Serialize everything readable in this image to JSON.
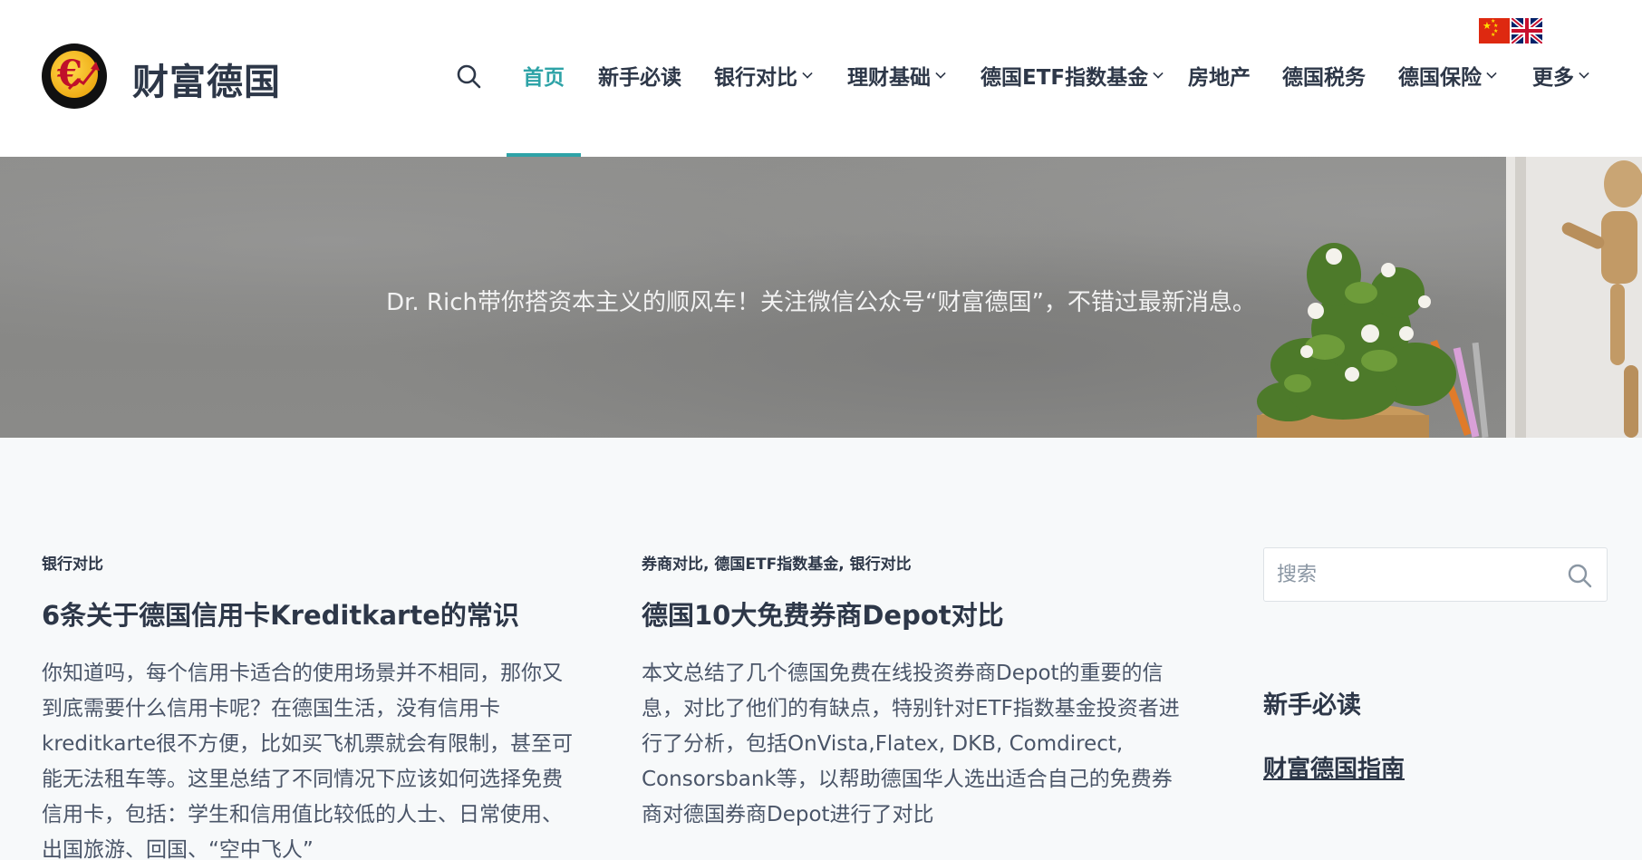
{
  "site": {
    "title": "财富德国"
  },
  "nav": {
    "items": [
      {
        "label": "首页",
        "active": true,
        "dropdown": false
      },
      {
        "label": "新手必读",
        "active": false,
        "dropdown": false
      },
      {
        "label": "银行对比",
        "active": false,
        "dropdown": true
      },
      {
        "label": "理财基础",
        "active": false,
        "dropdown": true
      },
      {
        "label": "德国ETF指数基金",
        "active": false,
        "dropdown": true
      },
      {
        "label": "房地产",
        "active": false,
        "dropdown": false
      },
      {
        "label": "德国税务",
        "active": false,
        "dropdown": false
      },
      {
        "label": "德国保险",
        "active": false,
        "dropdown": true
      },
      {
        "label": "更多",
        "active": false,
        "dropdown": true
      }
    ],
    "accent_color": "#2ea3a7"
  },
  "banner": {
    "text": "Dr. Rich带你搭资本主义的顺风车！关注微信公众号“财富德国”，不错过最新消息。"
  },
  "posts": [
    {
      "category": "银行对比",
      "title": "6条关于德国信用卡Kreditkarte的常识",
      "excerpt_lines": [
        "你知道吗，每个信用卡适合的使用场景并不相同，那你又",
        "到底需要什么信用卡呢？在德国生活，没有信用卡",
        "kreditkarte很不方便，比如买飞机票就会有限制，甚至可",
        "能无法租车等。这里总结了不同情况下应该如何选择免费",
        "信用卡，包括：学生和信用值比较低的人士、日常使用、",
        "出国旅游、回国、“空中飞人”"
      ]
    },
    {
      "category": "券商对比, 德国ETF指数基金, 银行对比",
      "title": "德国10大免费券商Depot对比",
      "excerpt_lines": [
        "本文总结了几个德国免费在线投资券商Depot的重要的信",
        "息，对比了他们的有缺点，特别针对ETF指数基金投资者进",
        "行了分析，包括OnVista,Flatex, DKB, Comdirect,",
        "Consorsbank等，以帮助德国华人选出适合自己的免费券",
        "商对德国券商Depot进行了对比"
      ]
    }
  ],
  "sidebar": {
    "search_placeholder": "搜索",
    "widget_title": "新手必读",
    "widget_link": "财富德国指南"
  },
  "icons": [
    "logo-euro-icon",
    "search-icon",
    "china-flag-icon",
    "uk-flag-icon",
    "chevron-down-icon"
  ]
}
